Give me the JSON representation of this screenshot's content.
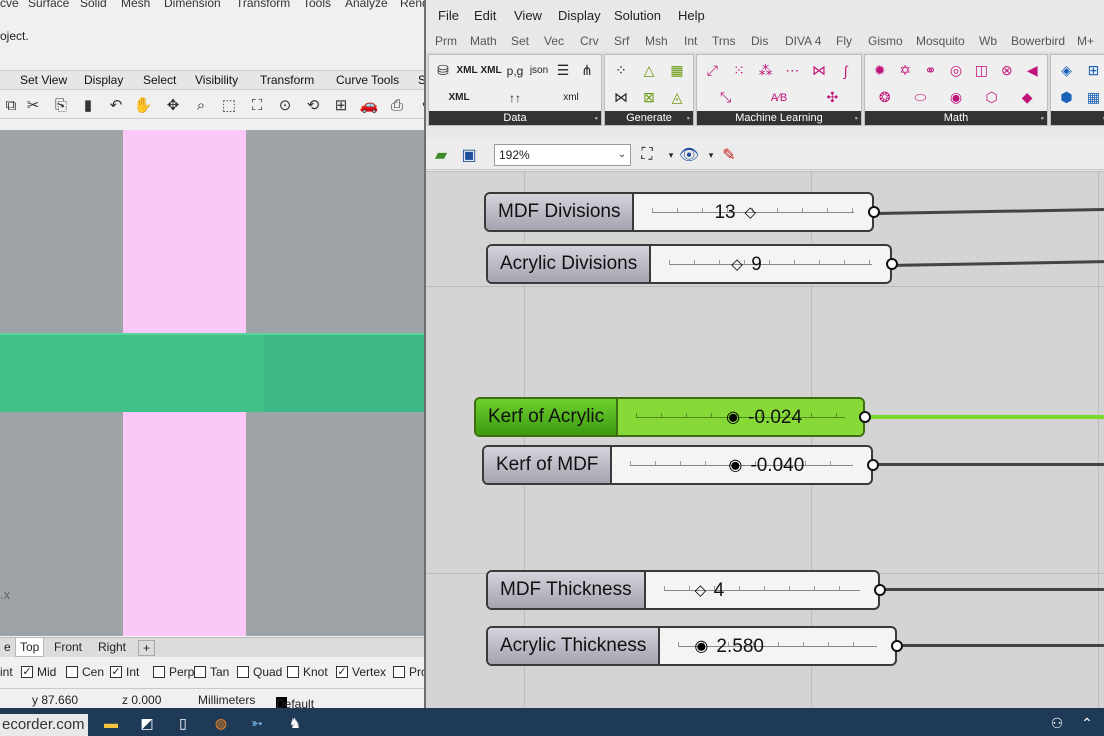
{
  "rhino": {
    "menu": [
      "cve",
      "Surface",
      "Solid",
      "Mesh",
      "Dimension",
      "Transform",
      "Tools",
      "Analyze",
      "Rend"
    ],
    "command_line": "oject.",
    "toolbar_tabs": [
      "Set View",
      "Display",
      "Select",
      "Visibility",
      "Transform",
      "Curve Tools",
      "S"
    ],
    "tool_icons": [
      "new-box-icon",
      "cut-icon",
      "copy-icon",
      "paste-icon",
      "undo-icon",
      "pan-hand-icon",
      "rotate-icon",
      "zoom-icon",
      "zoom-window-icon",
      "zoom-extents-icon",
      "zoom-selected-icon",
      "rotate-view-icon",
      "grid-icon",
      "car-render-icon",
      "print-icon",
      "help-icon"
    ],
    "viewport": {
      "axis_label": ".x",
      "colors": {
        "background": "#9ea3a8",
        "pink": "#fbc8f8",
        "green": "#40c28a"
      }
    },
    "view_tabs": [
      "e",
      "Top",
      "Front",
      "Right",
      "+"
    ],
    "osnaps": [
      {
        "label": "int",
        "checked": null
      },
      {
        "label": "Mid",
        "checked": true
      },
      {
        "label": "Cen",
        "checked": false
      },
      {
        "label": "Int",
        "checked": true
      },
      {
        "label": "Perp",
        "checked": false
      },
      {
        "label": "Tan",
        "checked": false
      },
      {
        "label": "Quad",
        "checked": false
      },
      {
        "label": "Knot",
        "checked": false
      },
      {
        "label": "Vertex",
        "checked": true
      },
      {
        "label": "Pro",
        "checked": false
      }
    ],
    "status": {
      "y": "y 87.660",
      "z": "z 0.000",
      "units": "Millimeters",
      "layer": "Default"
    }
  },
  "gh": {
    "menu": [
      "File",
      "Edit",
      "View",
      "Display",
      "Solution",
      "Help"
    ],
    "tabs": [
      "Prm",
      "Math",
      "Set",
      "Vec",
      "Crv",
      "Srf",
      "Msh",
      "Int",
      "Trns",
      "Dis",
      "DIVA 4",
      "Fly",
      "Gismo",
      "Mosquito",
      "Wb",
      "Bowerbird",
      "M+"
    ],
    "groups": [
      "Data",
      "Generate",
      "Machine Learning",
      "Math"
    ],
    "zoom": "192%",
    "sliders": [
      {
        "name": "MDF Divisions",
        "value": "13"
      },
      {
        "name": "Acrylic Divisions",
        "value": "9"
      },
      {
        "name": "Kerf of Acrylic",
        "value": "-0.024"
      },
      {
        "name": "Kerf of MDF",
        "value": "-0.040"
      },
      {
        "name": "MDF Thickness",
        "value": "4"
      },
      {
        "name": "Acrylic Thickness",
        "value": "2.580"
      }
    ],
    "colors": {
      "active_slider": "#86d936",
      "wire_active": "#7bd82e",
      "canvas": "#d4d4d4"
    }
  },
  "taskbar": {
    "recorder": "ecorder.com"
  }
}
